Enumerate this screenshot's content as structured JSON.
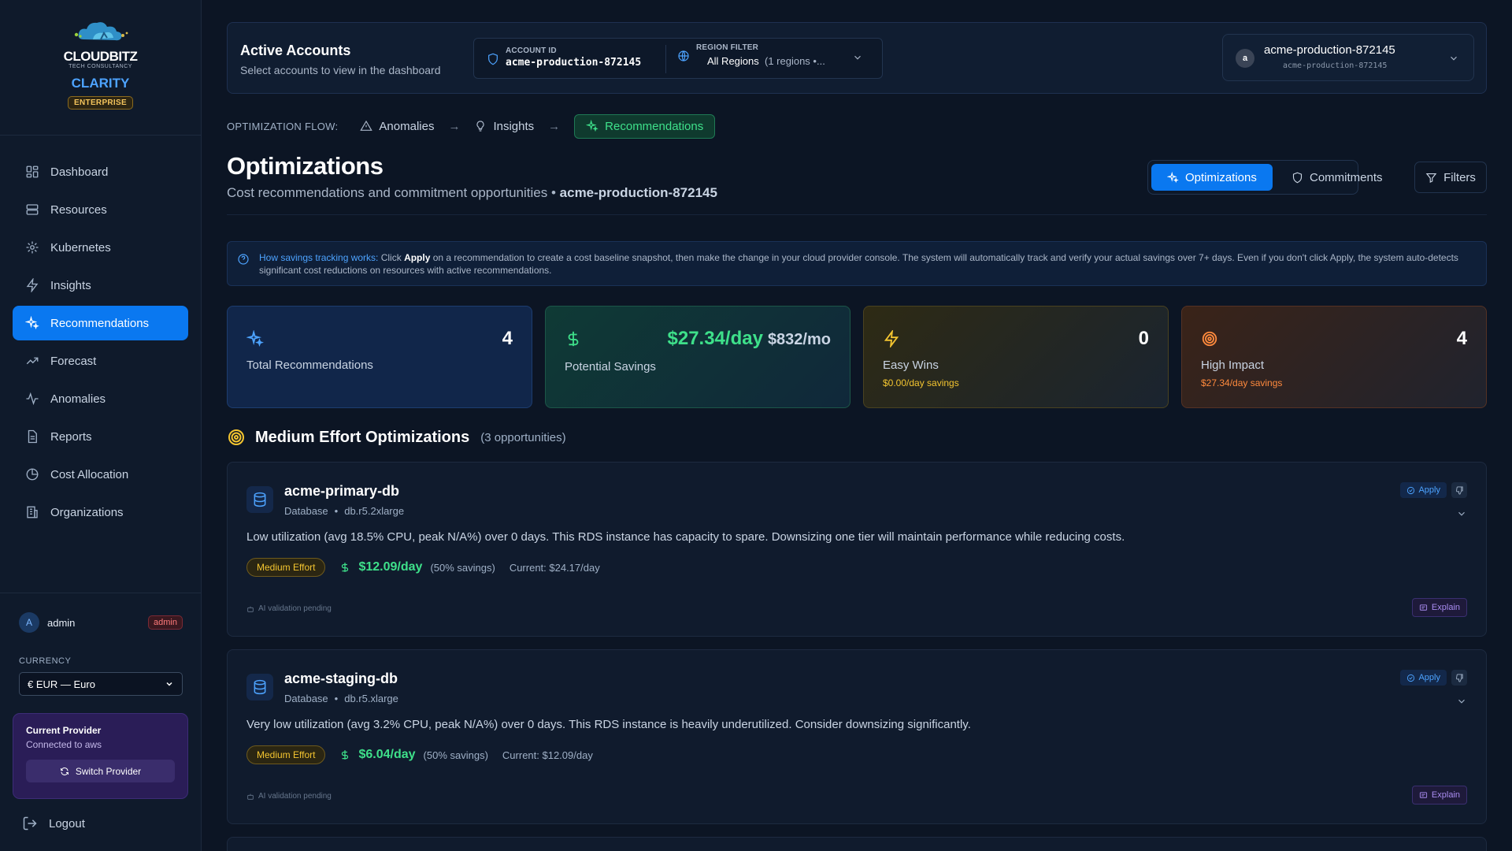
{
  "brand": {
    "logo_name": "CLOUDBITZ",
    "logo_tag": "TECH CONSULTANCY",
    "product": "CLARITY",
    "plan_badge": "ENTERPRISE"
  },
  "nav": {
    "items": [
      {
        "label": "Dashboard",
        "icon": "dashboard-icon"
      },
      {
        "label": "Resources",
        "icon": "server-icon"
      },
      {
        "label": "Kubernetes",
        "icon": "kubernetes-icon"
      },
      {
        "label": "Insights",
        "icon": "lightning-icon"
      },
      {
        "label": "Recommendations",
        "icon": "sparkles-icon",
        "active": true
      },
      {
        "label": "Forecast",
        "icon": "trending-up-icon"
      },
      {
        "label": "Anomalies",
        "icon": "activity-icon"
      },
      {
        "label": "Reports",
        "icon": "file-icon"
      },
      {
        "label": "Cost Allocation",
        "icon": "pie-chart-icon"
      },
      {
        "label": "Organizations",
        "icon": "building-icon"
      }
    ]
  },
  "user": {
    "initial": "A",
    "name": "admin",
    "role": "admin"
  },
  "currency": {
    "label": "CURRENCY",
    "value": "€ EUR — Euro"
  },
  "provider": {
    "title": "Current Provider",
    "subtitle": "Connected to aws",
    "switch_label": "Switch Provider"
  },
  "logout_label": "Logout",
  "accounts": {
    "title": "Active Accounts",
    "subtitle": "Select accounts to view in the dashboard",
    "account_id_label": "ACCOUNT ID",
    "account_id": "acme-production-872145",
    "region_label": "REGION FILTER",
    "region_value": "All Regions",
    "region_count": "(1 regions •...",
    "selected_initial": "a",
    "selected_name": "acme-production-872145",
    "selected_id": "acme-production-872145"
  },
  "flow": {
    "label": "OPTIMIZATION FLOW:",
    "steps": [
      "Anomalies",
      "Insights",
      "Recommendations"
    ],
    "arrow": "→"
  },
  "page": {
    "title": "Optimizations",
    "subtitle": "Cost recommendations and commitment opportunities •",
    "subtitle_account": "acme-production-872145",
    "toggle_on": "Optimizations",
    "toggle_off": "Commitments",
    "filters": "Filters"
  },
  "info": {
    "lead": "How savings tracking works:",
    "pre": " Click ",
    "apply_word": "Apply",
    "rest": " on a recommendation to create a cost baseline snapshot, then make the change in your cloud provider console. The system will automatically track and verify your actual savings over 7+ days. Even if you don't click Apply, the system auto-detects significant cost reductions on resources with active recommendations."
  },
  "stats": {
    "total": {
      "value": "4",
      "label": "Total Recommendations"
    },
    "savings": {
      "day": "$27.34/day",
      "month": "$832/mo",
      "label": "Potential Savings"
    },
    "easy": {
      "value": "0",
      "label": "Easy Wins",
      "sub": "$0.00/day savings"
    },
    "impact": {
      "value": "4",
      "label": "High Impact",
      "sub": "$27.34/day savings"
    }
  },
  "colors": {
    "accent": "#0a78f0",
    "green": "#3ee08a",
    "yellow": "#f4c530",
    "orange": "#ff8a3d"
  },
  "section": {
    "title": "Medium Effort Optimizations",
    "count": "(3 opportunities)"
  },
  "recommendations": [
    {
      "name": "acme-primary-db",
      "type": "Database",
      "instance": "db.r5.2xlarge",
      "description": "Low utilization (avg 18.5% CPU, peak N/A%) over 0 days. This RDS instance has capacity to spare. Downsizing one tier will maintain performance while reducing costs.",
      "effort": "Medium Effort",
      "savings": "$12.09/day",
      "savings_pct": "(50% savings)",
      "current": "Current: $24.17/day",
      "ai_status": "AI validation pending",
      "apply": "Apply",
      "explain": "Explain"
    },
    {
      "name": "acme-staging-db",
      "type": "Database",
      "instance": "db.r5.xlarge",
      "description": "Very low utilization (avg 3.2% CPU, peak N/A%) over 0 days. This RDS instance is heavily underutilized. Consider downsizing significantly.",
      "effort": "Medium Effort",
      "savings": "$6.04/day",
      "savings_pct": "(50% savings)",
      "current": "Current: $12.09/day",
      "ai_status": "AI validation pending",
      "apply": "Apply",
      "explain": "Explain"
    }
  ]
}
